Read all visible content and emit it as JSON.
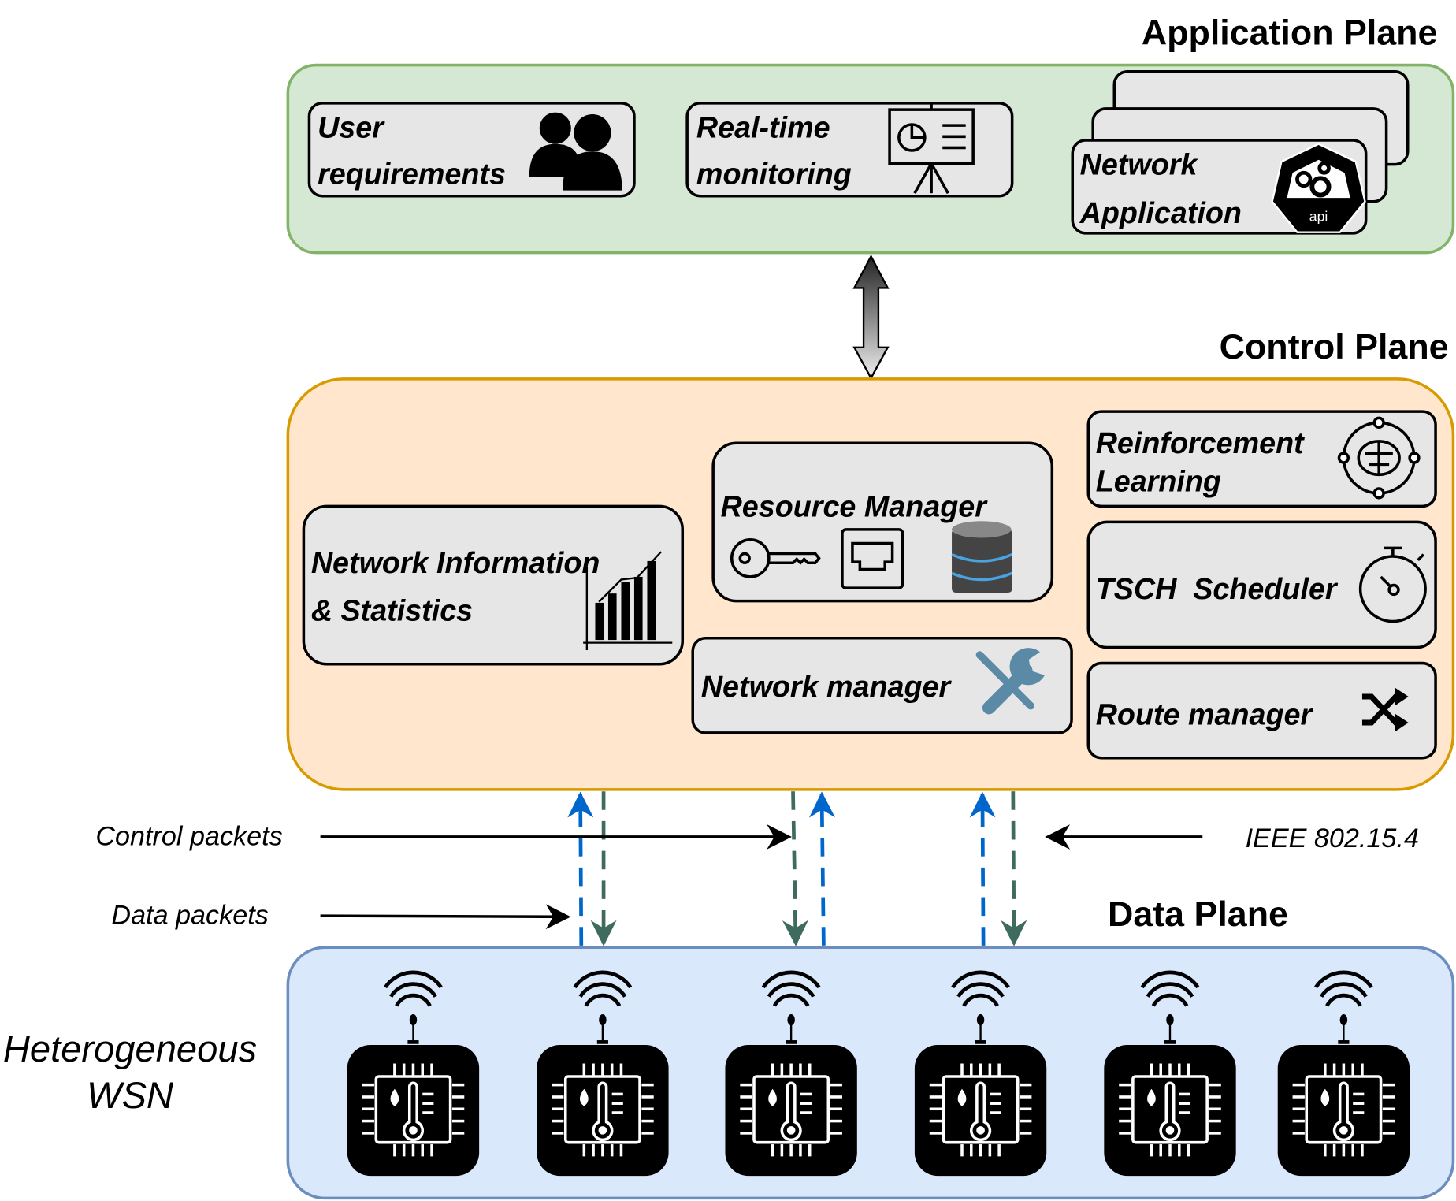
{
  "application_plane": {
    "title": "Application Plane",
    "user_requirements": {
      "line1": "User",
      "line2": "requirements",
      "icon": "users-icon"
    },
    "realtime_monitoring": {
      "line1": "Real-time",
      "line2": "monitoring",
      "icon": "presentation-chart-icon"
    },
    "network_application": {
      "line1": "Network",
      "line2": "Application",
      "icon": "api-gears-icon",
      "badge": "api"
    }
  },
  "control_plane": {
    "title": "Control Plane",
    "network_info": {
      "line1": "Network Information",
      "line2": "& Statistics",
      "icon": "bar-chart-icon"
    },
    "resource_manager": {
      "label": "Resource Manager",
      "icons": [
        "key-icon",
        "ethernet-port-icon",
        "database-icon"
      ]
    },
    "network_manager": {
      "label": "Network manager",
      "icon": "tools-icon"
    },
    "reinforcement_learning": {
      "line1": "Reinforcement",
      "line2": "Learning",
      "icon": "brain-cycle-icon"
    },
    "tsch_scheduler": {
      "label": "TSCH  Scheduler",
      "icon": "stopwatch-icon"
    },
    "route_manager": {
      "label": "Route manager",
      "icon": "shuffle-icon"
    }
  },
  "legend": {
    "control_packets": "Control packets",
    "data_packets": "Data packets",
    "ieee": "IEEE 802.15.4"
  },
  "data_plane": {
    "title": "Data Plane",
    "wsn_line1": "Heterogeneous",
    "wsn_line2": "WSN",
    "sensor_node_count": 6,
    "sensor_icon": "temperature-sensor-chip-icon"
  },
  "colors": {
    "application_fill": "#d5e8d4",
    "application_stroke": "#82b366",
    "control_fill": "#ffe6cc",
    "control_stroke": "#d79b00",
    "data_fill": "#dae8fc",
    "data_stroke": "#6c8ebf",
    "uplink": "#0066cc",
    "downlink": "#3f6b5e"
  }
}
